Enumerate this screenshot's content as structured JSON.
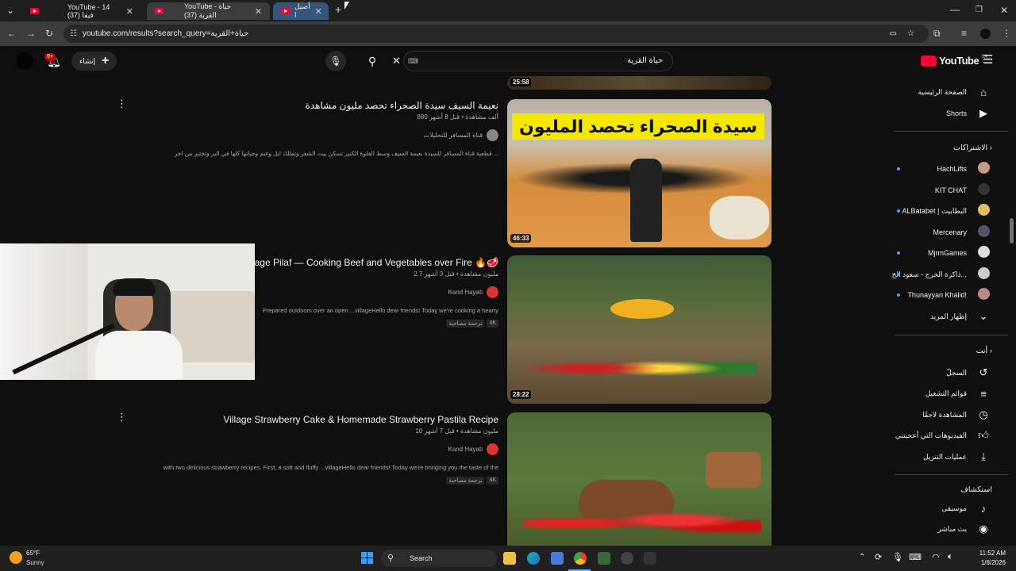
{
  "browser": {
    "tabs": [
      {
        "label": "YouTube - 14 فيفا (37)",
        "active": false
      },
      {
        "label": "YouTube - حياة القرية (37)",
        "active": true
      },
      {
        "label": "أصيل ا",
        "active": false
      }
    ],
    "url": "youtube.com/results?search_query=حياة+القرية"
  },
  "youtube": {
    "search_value": "حياة القرية",
    "create_label": "إنشاء",
    "notif_count": "9+",
    "logo": "YouTube",
    "region": "SA"
  },
  "sidebar": {
    "top": [
      {
        "label": "الصفحة الرئيسية",
        "icon": "home-icon"
      },
      {
        "label": "Shorts",
        "icon": "shorts-icon"
      }
    ],
    "subs_header": "الاشتراكات",
    "subs": [
      {
        "label": "HachLifts",
        "color": "#c79a8a"
      },
      {
        "label": "KIT CHAT",
        "color": "#333"
      },
      {
        "label": "ALBatabet | البطابيت",
        "color": "#e0c060"
      },
      {
        "label": "Mercenary",
        "color": "#556"
      },
      {
        "label": "MjrmGames",
        "color": "#ddd"
      },
      {
        "label": "ذاكرة الخرج - سعود الخ...",
        "color": "#ccc"
      },
      {
        "label": "Thunayyan Khalid!",
        "color": "#b88"
      }
    ],
    "show_more": "إظهار المزيد",
    "you_header": "أنت",
    "you": [
      {
        "label": "السجلّ",
        "icon": "history-icon"
      },
      {
        "label": "قوائم التشغيل",
        "icon": "playlist-icon"
      },
      {
        "label": "المشاهدة لاحقًا",
        "icon": "clock-icon"
      },
      {
        "label": "الفيديوهات التي أعجبتني",
        "icon": "like-icon"
      },
      {
        "label": "عمليات التنزيل",
        "icon": "download-icon"
      }
    ],
    "explore_header": "استكشاف",
    "explore": [
      {
        "label": "موسيقى",
        "icon": "music-icon"
      },
      {
        "label": "بث مباشر",
        "icon": "live-icon"
      }
    ]
  },
  "videos": [
    {
      "duration": "25:58"
    },
    {
      "title": "نعيمة السيف سيدة الصحراء تحصد مليون مشاهدة",
      "meta": "880 ألف مشاهدة • قبل 8 أشهر",
      "channel": "قناة المسافر للتحليلات",
      "desc": "قطعية قناة المسافر للسيدة نعيمة السيف وسط الفلوة الكبير تسكن بيت الشعر وتطلك ابل وغنم وحياتها كلها في البر وتختبر من اخر ...",
      "duration": "46:33",
      "thumb_text": "سيدة الصحراء تحصد المليون"
    },
    {
      "title": "Village Pilaf — Cooking Beef and Vegetables over Fire 🔥🥩",
      "meta": "2.7 مليون مشاهدة • قبل 3 أشهر",
      "channel": "Kand Hayati",
      "desc": "Prepared outdoors over an open ...villageHello dear friends! Today we're cooking a hearty",
      "badges": [
        "4K",
        "ترجمة مصاحبة"
      ],
      "duration": "28:22"
    },
    {
      "title": "Village Strawberry Cake & Homemade Strawberry Pastila Recipe",
      "meta": "10 مليون مشاهدة • قبل 7 أشهر",
      "channel": "Kand Hayati",
      "desc": "with two delicious strawberry recipes. First, a soft and fluffy ...villageHello dear friends! Today we're bringing you the taste of the",
      "badges": [
        "4K",
        "ترجمة مصاحبة"
      ]
    }
  ],
  "taskbar": {
    "weather_temp": "65°F",
    "weather_desc": "Sunny",
    "search": "Search",
    "time": "11:52 AM",
    "date": "1/8/2026"
  },
  "colors": {
    "youtube_red": "#ff0033",
    "accent_blue": "#3ea6ff",
    "bg": "#0f0f0f"
  }
}
